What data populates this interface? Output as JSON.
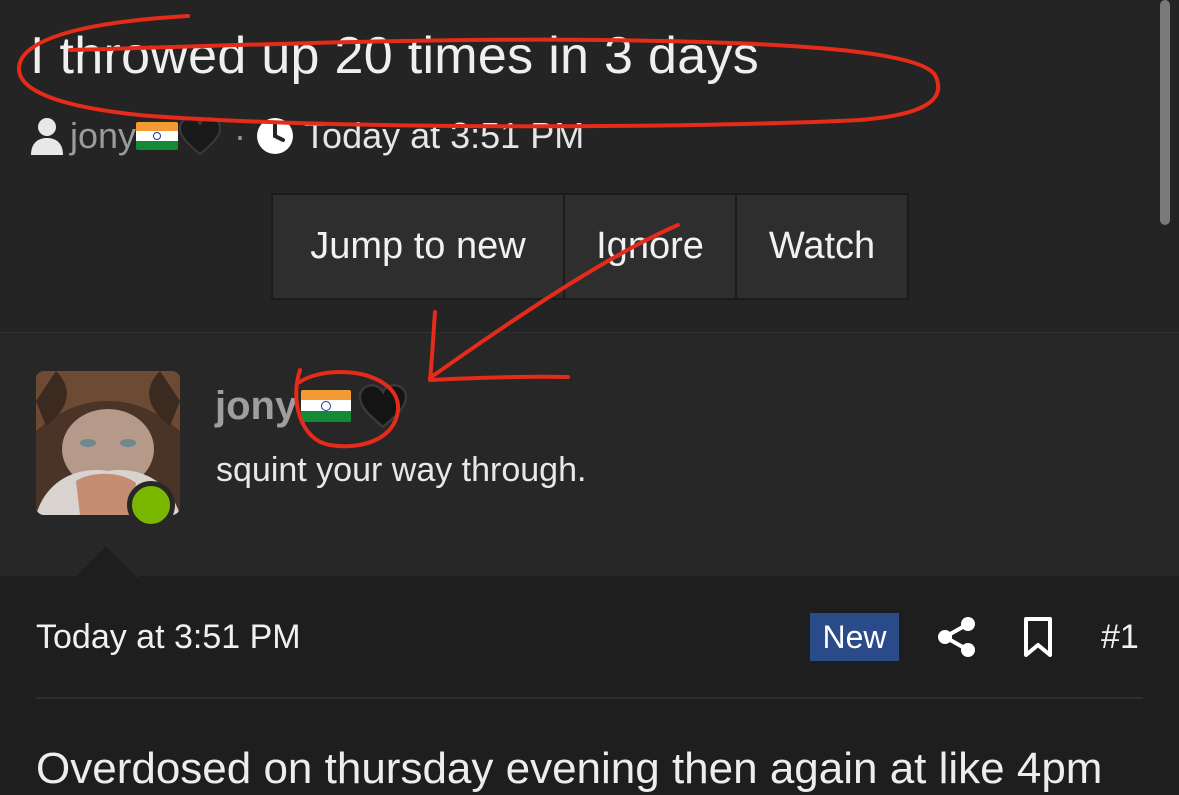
{
  "thread": {
    "title": "I throwed up 20 times in 3 days",
    "author": "jony",
    "separator": "·",
    "date": "Today at 3:51 PM"
  },
  "actions": {
    "jump_to_new": "Jump to new",
    "ignore": "Ignore",
    "watch": "Watch"
  },
  "user": {
    "name": "jony",
    "title": "squint your way through.",
    "status": "online"
  },
  "post": {
    "date": "Today at 3:51 PM",
    "badge": "New",
    "number": "#1",
    "body": "Overdosed on thursday evening then again at like 4pm"
  },
  "icons": [
    "user-icon",
    "india-flag-icon",
    "black-heart-icon",
    "clock-icon",
    "share-icon",
    "bookmark-icon"
  ],
  "colors": {
    "background": "#242424",
    "post_background": "#1e1e1e",
    "badge": "#2a4a8a",
    "online": "#7ab800",
    "annotation": "#e52b1a"
  }
}
